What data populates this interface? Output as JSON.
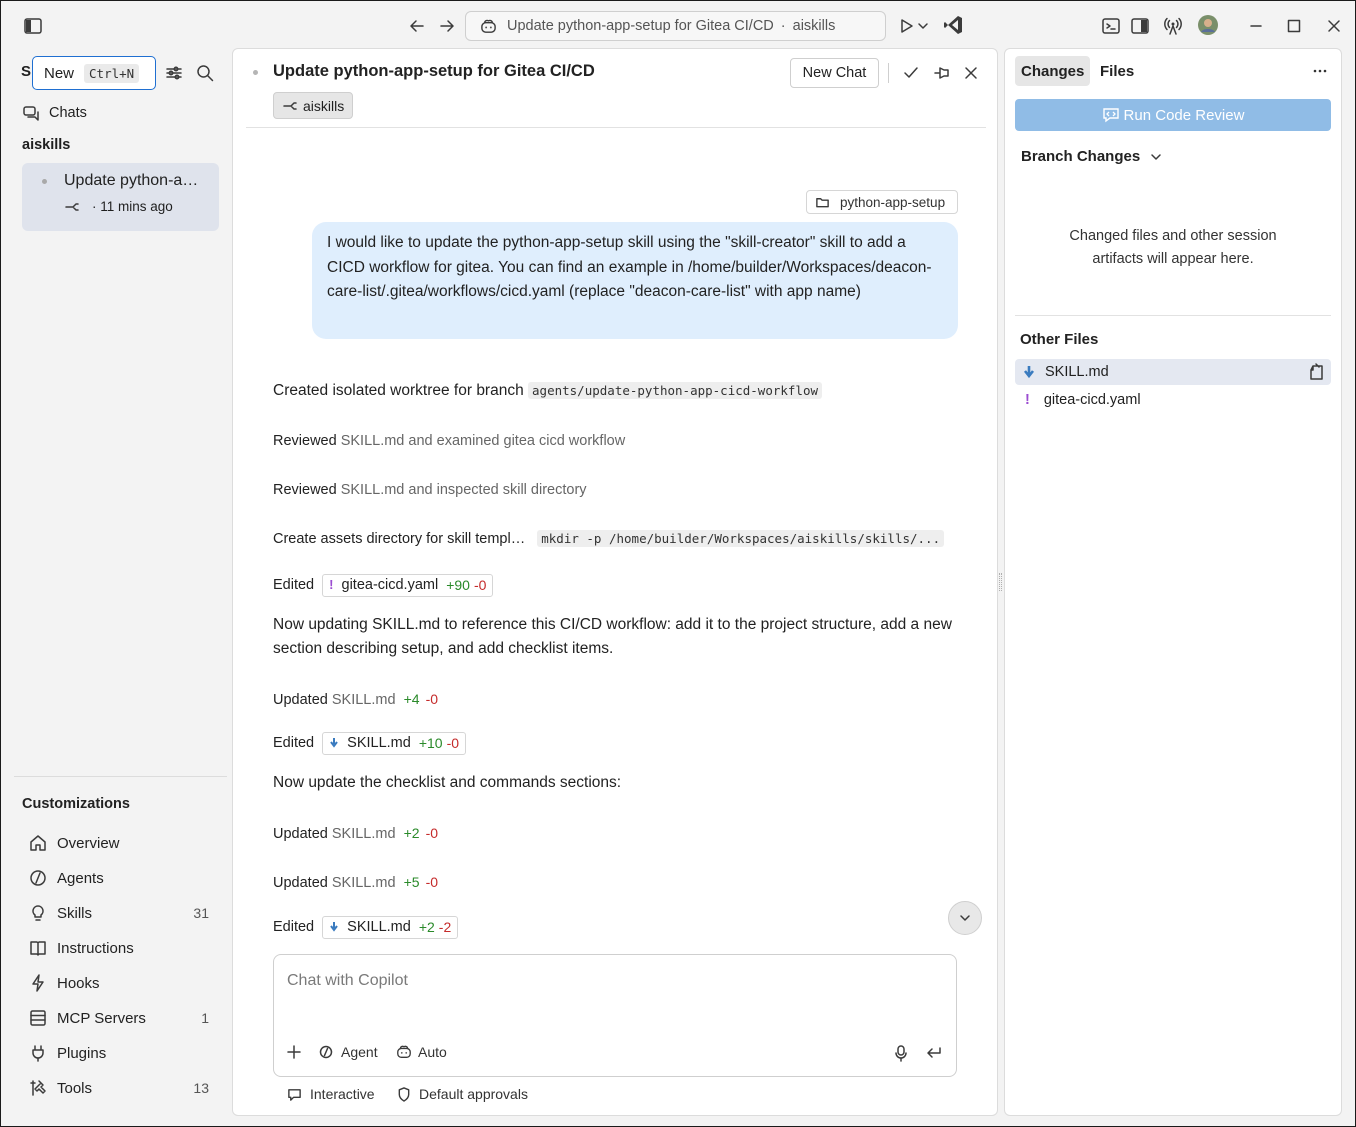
{
  "titlebar": {
    "address_title": "Update python-app-setup for Gitea CI/CD",
    "address_sep": "·",
    "address_repo": "aiskills"
  },
  "sidebar": {
    "truncated_label": "S.",
    "new_label": "New",
    "new_shortcut": "Ctrl+N",
    "chats_label": "Chats",
    "group_label": "aiskills",
    "chat_item": {
      "title": "Update python-a…",
      "time": "11 mins ago"
    },
    "customizations_label": "Customizations",
    "customizations": [
      {
        "label": "Overview",
        "icon": "home-icon",
        "count": ""
      },
      {
        "label": "Agents",
        "icon": "agent-icon",
        "count": ""
      },
      {
        "label": "Skills",
        "icon": "lightbulb-icon",
        "count": "31"
      },
      {
        "label": "Instructions",
        "icon": "book-icon",
        "count": ""
      },
      {
        "label": "Hooks",
        "icon": "lightning-icon",
        "count": ""
      },
      {
        "label": "MCP Servers",
        "icon": "server-icon",
        "count": "1"
      },
      {
        "label": "Plugins",
        "icon": "plug-icon",
        "count": ""
      },
      {
        "label": "Tools",
        "icon": "tools-icon",
        "count": "13"
      }
    ]
  },
  "chat": {
    "title": "Update python-app-setup for Gitea CI/CD",
    "repo_tag": "aiskills",
    "new_chat_label": "New Chat",
    "folder_chip": "python-app-setup",
    "user_message": "I would like to update the python-app-setup skill using the \"skill-creator\" skill to add a CICD workflow for gitea. You can find an example in /home/builder/Workspaces/deacon-care-list/.gitea/workflows/cicd.yaml (replace \"deacon-care-list\" with app name)",
    "m1_text": "Created isolated worktree for branch",
    "m1_code": "agents/update-python-app-cicd-workflow",
    "m2_a": "Reviewed",
    "m2_b": "SKILL.md and examined gitea cicd workflow",
    "m3_a": "Reviewed",
    "m3_b": "SKILL.md and inspected skill directory",
    "m4_text": "Create assets directory for skill templ…",
    "m4_code": "mkdir -p /home/builder/Workspaces/aiskills/skills/...",
    "m5": {
      "verb": "Edited",
      "icon": "!",
      "file": "gitea-cicd.yaml",
      "plus": "+90",
      "minus": "-0"
    },
    "m6": "Now updating SKILL.md to reference this CI/CD workflow: add it to the project structure, add a new section describing setup, and add checklist items.",
    "m7": {
      "verb": "Updated",
      "file": "SKILL.md",
      "plus": "+4",
      "minus": "-0"
    },
    "m8": {
      "verb": "Edited",
      "file": "SKILL.md",
      "plus": "+10",
      "minus": "-0"
    },
    "m9": "Now update the checklist and commands sections:",
    "m10": {
      "verb": "Updated",
      "file": "SKILL.md",
      "plus": "+2",
      "minus": "-0"
    },
    "m11": {
      "verb": "Updated",
      "file": "SKILL.md",
      "plus": "+5",
      "minus": "-0"
    },
    "m12": {
      "verb": "Edited",
      "file": "SKILL.md",
      "plus": "+2",
      "minus": "-2"
    },
    "input_placeholder": "Chat with Copilot",
    "agent_label": "Agent",
    "model_label": "Auto",
    "mode_label": "Interactive",
    "approvals_label": "Default approvals"
  },
  "right_panel": {
    "tab_changes": "Changes",
    "tab_files": "Files",
    "run_review": "Run Code Review",
    "branch_changes": "Branch Changes",
    "empty_line1": "Changed files and other session",
    "empty_line2": "artifacts will appear here.",
    "other_files_label": "Other Files",
    "files": [
      "SKILL.md",
      "gitea-cicd.yaml"
    ]
  },
  "colors": {
    "accent": "#1f6fd1",
    "review_button": "#90bce6",
    "user_bubble": "#dfeefd",
    "selected_item": "#dfe3ec"
  }
}
